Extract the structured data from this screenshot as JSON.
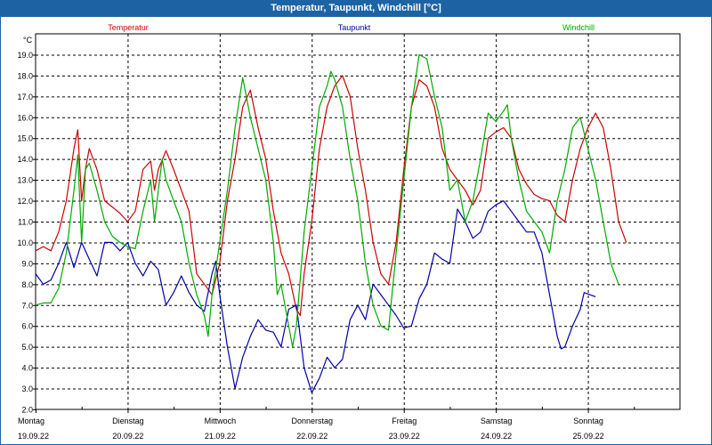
{
  "window": {
    "title": "Temperatur, Taupunkt, Windchill [°C]"
  },
  "colors": {
    "titlebar": "#1d63a3",
    "temperatur": "#cc0000",
    "taupunkt": "#0000aa",
    "windchill": "#00aa00",
    "grid": "#000000"
  },
  "chart_data": {
    "type": "line",
    "title": "Temperatur, Taupunkt, Windchill [°C]",
    "ylabel": "°C",
    "ylim": [
      2.0,
      20.0
    ],
    "y_ticks": [
      "2.0",
      "3.0",
      "4.0",
      "5.0",
      "6.0",
      "7.0",
      "8.0",
      "9.0",
      "10.0",
      "11.0",
      "12.0",
      "13.0",
      "14.0",
      "15.0",
      "16.0",
      "17.0",
      "18.0",
      "19.0"
    ],
    "x_ticks": [
      {
        "day": "Montag",
        "date": "19.09.22"
      },
      {
        "day": "Dienstag",
        "date": "20.09.22"
      },
      {
        "day": "Mittwoch",
        "date": "21.09.22"
      },
      {
        "day": "Donnerstag",
        "date": "22.09.22"
      },
      {
        "day": "Freitag",
        "date": "23.09.22"
      },
      {
        "day": "Samstag",
        "date": "24.09.22"
      },
      {
        "day": "Sonntag",
        "date": "25.09.22"
      }
    ],
    "x_unit": "hours since 19.09.22 00:00",
    "xlim": [
      0,
      168
    ],
    "grid": true,
    "legend_placement": "top",
    "series": [
      {
        "name": "Temperatur",
        "color": "#cc0000",
        "points": [
          [
            0,
            9.6
          ],
          [
            2,
            9.8
          ],
          [
            4,
            9.6
          ],
          [
            6,
            10.5
          ],
          [
            8,
            12.0
          ],
          [
            10,
            14.5
          ],
          [
            11,
            15.4
          ],
          [
            12,
            12.0
          ],
          [
            13,
            13.5
          ],
          [
            14,
            14.5
          ],
          [
            16,
            13.5
          ],
          [
            18,
            12.0
          ],
          [
            20,
            11.7
          ],
          [
            22,
            11.4
          ],
          [
            24,
            11.0
          ],
          [
            26,
            11.5
          ],
          [
            28,
            13.5
          ],
          [
            30,
            13.9
          ],
          [
            31,
            12.5
          ],
          [
            32,
            13.5
          ],
          [
            34,
            14.4
          ],
          [
            36,
            13.5
          ],
          [
            38,
            12.5
          ],
          [
            40,
            11.5
          ],
          [
            42,
            8.5
          ],
          [
            44,
            8.0
          ],
          [
            46,
            7.5
          ],
          [
            48,
            9.0
          ],
          [
            50,
            12.0
          ],
          [
            52,
            14.0
          ],
          [
            54,
            16.5
          ],
          [
            56,
            17.3
          ],
          [
            58,
            15.5
          ],
          [
            60,
            14.0
          ],
          [
            62,
            11.5
          ],
          [
            64,
            9.5
          ],
          [
            66,
            8.5
          ],
          [
            68,
            6.8
          ],
          [
            69,
            6.5
          ],
          [
            70,
            8.5
          ],
          [
            72,
            11.0
          ],
          [
            74,
            14.5
          ],
          [
            76,
            16.5
          ],
          [
            78,
            17.5
          ],
          [
            80,
            18.0
          ],
          [
            82,
            17.0
          ],
          [
            84,
            14.5
          ],
          [
            86,
            12.5
          ],
          [
            88,
            10.0
          ],
          [
            90,
            8.5
          ],
          [
            92,
            8.0
          ],
          [
            94,
            10.0
          ],
          [
            96,
            13.5
          ],
          [
            98,
            16.5
          ],
          [
            100,
            17.8
          ],
          [
            102,
            17.5
          ],
          [
            104,
            16.5
          ],
          [
            106,
            14.5
          ],
          [
            108,
            13.5
          ],
          [
            110,
            13.0
          ],
          [
            112,
            12.5
          ],
          [
            114,
            11.8
          ],
          [
            116,
            12.5
          ],
          [
            118,
            15.0
          ],
          [
            120,
            15.3
          ],
          [
            122,
            15.5
          ],
          [
            124,
            15.0
          ],
          [
            126,
            13.5
          ],
          [
            128,
            12.8
          ],
          [
            130,
            12.3
          ],
          [
            132,
            12.1
          ],
          [
            134,
            12.0
          ],
          [
            136,
            11.3
          ],
          [
            138,
            11.0
          ],
          [
            140,
            13.0
          ],
          [
            142,
            14.5
          ],
          [
            144,
            15.5
          ],
          [
            146,
            16.2
          ],
          [
            148,
            15.5
          ],
          [
            150,
            13.5
          ],
          [
            152,
            11.0
          ],
          [
            154,
            10.0
          ]
        ]
      },
      {
        "name": "Taupunkt",
        "color": "#0000aa",
        "points": [
          [
            0,
            8.5
          ],
          [
            2,
            8.0
          ],
          [
            4,
            8.2
          ],
          [
            6,
            9.0
          ],
          [
            8,
            10.0
          ],
          [
            10,
            8.8
          ],
          [
            12,
            10.0
          ],
          [
            14,
            9.2
          ],
          [
            16,
            8.4
          ],
          [
            18,
            10.0
          ],
          [
            20,
            10.0
          ],
          [
            22,
            9.6
          ],
          [
            24,
            10.0
          ],
          [
            26,
            9.0
          ],
          [
            28,
            8.4
          ],
          [
            30,
            9.1
          ],
          [
            32,
            8.7
          ],
          [
            34,
            7.0
          ],
          [
            36,
            7.6
          ],
          [
            38,
            8.4
          ],
          [
            40,
            7.6
          ],
          [
            42,
            7.0
          ],
          [
            44,
            6.7
          ],
          [
            46,
            8.5
          ],
          [
            47,
            9.1
          ],
          [
            48,
            7.5
          ],
          [
            50,
            5.0
          ],
          [
            52,
            3.0
          ],
          [
            54,
            4.5
          ],
          [
            56,
            5.5
          ],
          [
            58,
            6.3
          ],
          [
            60,
            5.8
          ],
          [
            62,
            5.7
          ],
          [
            64,
            5.0
          ],
          [
            66,
            6.8
          ],
          [
            68,
            7.0
          ],
          [
            70,
            4.0
          ],
          [
            72,
            2.8
          ],
          [
            74,
            3.5
          ],
          [
            76,
            4.5
          ],
          [
            78,
            4.0
          ],
          [
            80,
            4.4
          ],
          [
            82,
            6.3
          ],
          [
            84,
            7.0
          ],
          [
            86,
            6.3
          ],
          [
            88,
            8.0
          ],
          [
            90,
            7.5
          ],
          [
            92,
            7.0
          ],
          [
            94,
            6.5
          ],
          [
            96,
            5.9
          ],
          [
            98,
            6.0
          ],
          [
            100,
            7.3
          ],
          [
            102,
            8.0
          ],
          [
            104,
            9.5
          ],
          [
            106,
            9.2
          ],
          [
            108,
            9.0
          ],
          [
            110,
            11.6
          ],
          [
            112,
            11.0
          ],
          [
            114,
            10.2
          ],
          [
            116,
            10.5
          ],
          [
            118,
            11.5
          ],
          [
            120,
            11.8
          ],
          [
            122,
            12.0
          ],
          [
            124,
            11.5
          ],
          [
            126,
            11.0
          ],
          [
            128,
            10.5
          ],
          [
            130,
            10.5
          ],
          [
            132,
            9.5
          ],
          [
            134,
            7.5
          ],
          [
            136,
            5.5
          ],
          [
            137,
            4.9
          ],
          [
            138,
            5.0
          ],
          [
            140,
            6.0
          ],
          [
            142,
            6.8
          ],
          [
            143,
            7.6
          ],
          [
            146,
            7.4
          ]
        ]
      },
      {
        "name": "Windchill",
        "color": "#00aa00",
        "points": [
          [
            0,
            7.0
          ],
          [
            2,
            7.1
          ],
          [
            4,
            7.1
          ],
          [
            6,
            7.8
          ],
          [
            8,
            9.5
          ],
          [
            10,
            12.5
          ],
          [
            11,
            14.2
          ],
          [
            12,
            10.0
          ],
          [
            13,
            13.5
          ],
          [
            14,
            13.8
          ],
          [
            16,
            12.5
          ],
          [
            18,
            11.0
          ],
          [
            20,
            10.3
          ],
          [
            22,
            10.0
          ],
          [
            24,
            9.8
          ],
          [
            26,
            9.7
          ],
          [
            28,
            11.5
          ],
          [
            30,
            13.0
          ],
          [
            31,
            11.0
          ],
          [
            32,
            12.5
          ],
          [
            33,
            14.0
          ],
          [
            34,
            13.0
          ],
          [
            36,
            12.0
          ],
          [
            38,
            11.0
          ],
          [
            40,
            9.0
          ],
          [
            42,
            7.5
          ],
          [
            44,
            6.5
          ],
          [
            45,
            5.5
          ],
          [
            46,
            7.5
          ],
          [
            48,
            10.0
          ],
          [
            50,
            12.5
          ],
          [
            52,
            15.5
          ],
          [
            54,
            17.9
          ],
          [
            56,
            16.0
          ],
          [
            58,
            14.5
          ],
          [
            60,
            13.0
          ],
          [
            62,
            10.0
          ],
          [
            63,
            7.5
          ],
          [
            64,
            8.0
          ],
          [
            66,
            6.0
          ],
          [
            67,
            5.0
          ],
          [
            68,
            6.0
          ],
          [
            70,
            10.5
          ],
          [
            72,
            13.5
          ],
          [
            74,
            16.5
          ],
          [
            76,
            17.5
          ],
          [
            77,
            18.2
          ],
          [
            78,
            17.8
          ],
          [
            80,
            16.5
          ],
          [
            82,
            14.0
          ],
          [
            84,
            12.0
          ],
          [
            86,
            9.0
          ],
          [
            88,
            7.0
          ],
          [
            90,
            6.0
          ],
          [
            92,
            5.8
          ],
          [
            94,
            9.5
          ],
          [
            96,
            13.0
          ],
          [
            98,
            16.5
          ],
          [
            100,
            19.0
          ],
          [
            102,
            18.8
          ],
          [
            104,
            17.0
          ],
          [
            106,
            15.5
          ],
          [
            108,
            12.5
          ],
          [
            110,
            13.0
          ],
          [
            112,
            11.0
          ],
          [
            114,
            12.0
          ],
          [
            116,
            14.0
          ],
          [
            118,
            16.2
          ],
          [
            120,
            15.8
          ],
          [
            122,
            16.3
          ],
          [
            123,
            16.6
          ],
          [
            124,
            15.0
          ],
          [
            126,
            13.0
          ],
          [
            128,
            11.5
          ],
          [
            130,
            11.0
          ],
          [
            132,
            10.5
          ],
          [
            134,
            9.5
          ],
          [
            136,
            12.0
          ],
          [
            138,
            13.5
          ],
          [
            140,
            15.5
          ],
          [
            142,
            16.0
          ],
          [
            144,
            14.5
          ],
          [
            146,
            13.0
          ],
          [
            148,
            11.0
          ],
          [
            150,
            9.0
          ],
          [
            152,
            8.0
          ]
        ]
      }
    ]
  }
}
